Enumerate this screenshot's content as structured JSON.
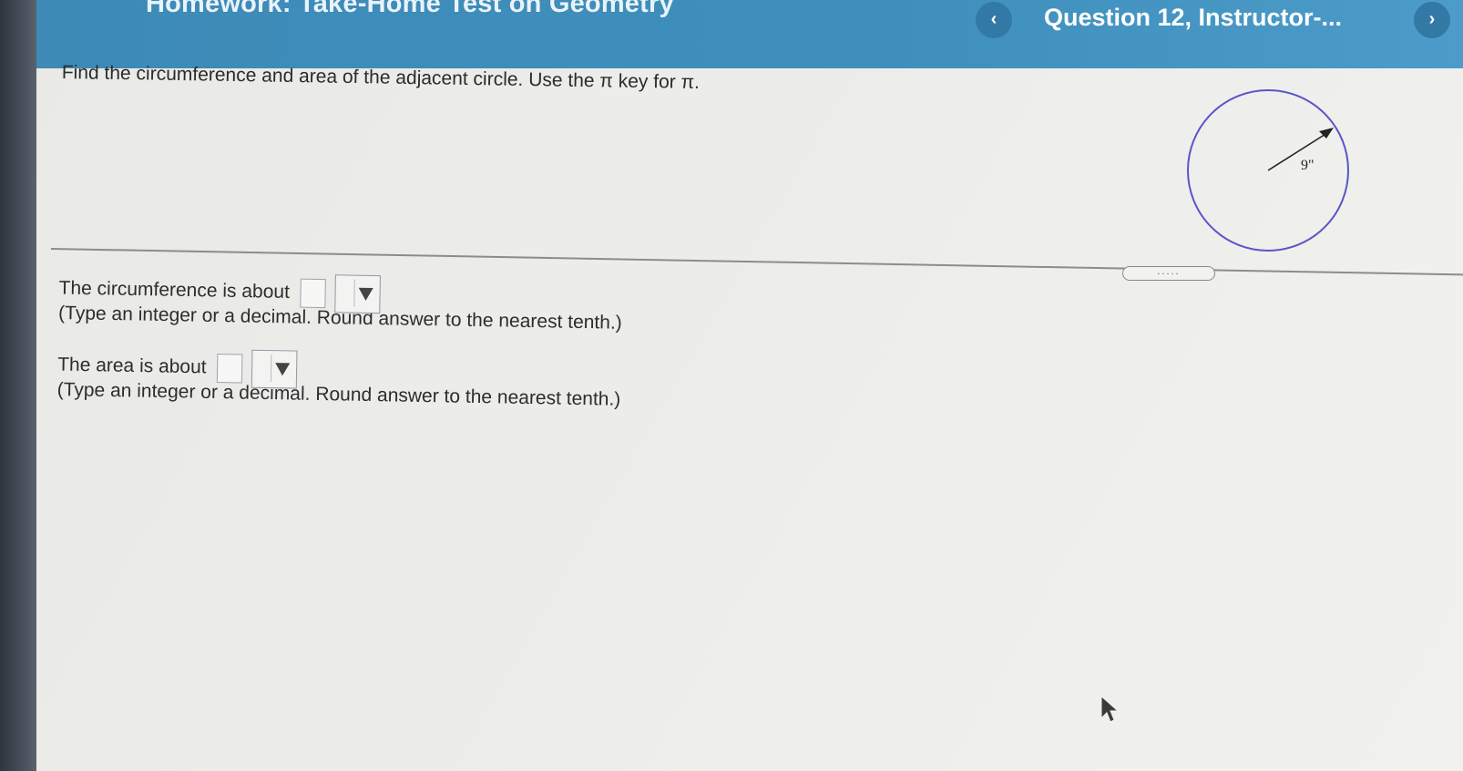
{
  "header": {
    "title": "Homework: Take-Home Test on Geometry",
    "question_label": "Question 12, Instructor-...",
    "prev_icon": "‹",
    "next_icon": "›"
  },
  "prompt": "Find the circumference and area of the adjacent circle. Use the π key for π.",
  "figure": {
    "radius_label": "9\""
  },
  "resize_handle": ".....",
  "answers": {
    "circumference_label": "The circumference is about",
    "circumference_hint": "(Type an integer or a decimal. Round answer to the nearest tenth.)",
    "area_label": "The area is about",
    "area_hint": "(Type an integer or a decimal. Round answer to the nearest tenth.)"
  },
  "colors": {
    "header": "#3f8fbd",
    "circle": "#5a55c8"
  }
}
